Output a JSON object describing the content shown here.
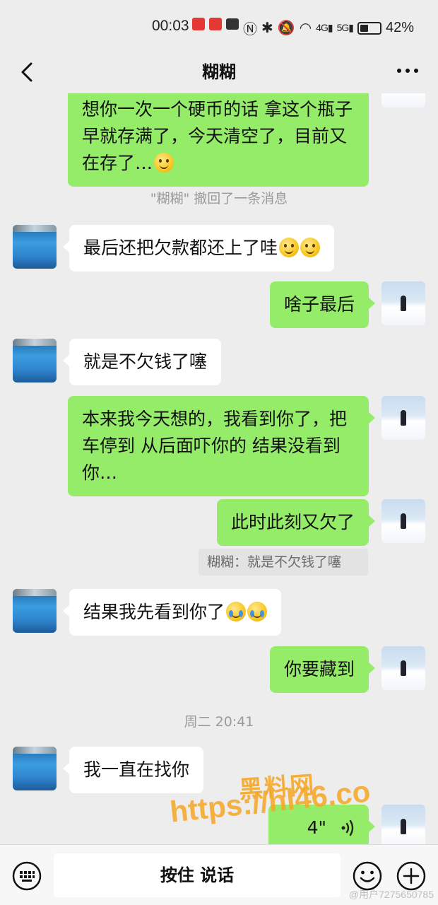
{
  "status_bar": {
    "time": "00:03",
    "battery": "42%",
    "battery_level": 0.42,
    "network_a": "4G",
    "network_b": "5G"
  },
  "header": {
    "title": "糊糊"
  },
  "messages": {
    "m1": "想你一次一个硬币的话 拿这个瓶子早就存满了，今天清空了，目前又在存了…",
    "recall": "\"糊糊\" 撤回了一条消息",
    "m2": "最后还把欠款都还上了哇",
    "m3": "啥子最后",
    "m4": "就是不欠钱了噻",
    "m5": "本来我今天想的，我看到你了，把车停到 从后面吓你的 结果没看到你…",
    "m6": "此时此刻又欠了",
    "quote": "糊糊：就是不欠钱了噻",
    "m7": "结果我先看到你了",
    "m8": "你要藏到",
    "time_divider": "周二 20:41",
    "m9": "我一直在找你",
    "voice_duration": "4\""
  },
  "watermark": {
    "line1": "黑料网",
    "line2": "https://hl46.co",
    "corner": "@用户7275650785"
  },
  "input_bar": {
    "talk_label": "按住 说话"
  },
  "icons": [
    "back-icon",
    "more-icon",
    "keyboard-icon",
    "smile-icon",
    "plus-icon",
    "voice-wave-icon"
  ]
}
